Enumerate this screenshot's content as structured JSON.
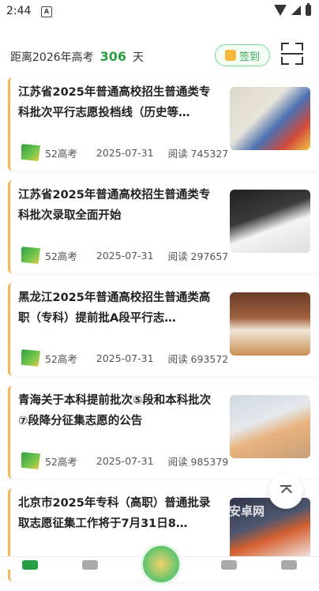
{
  "status_bar": {
    "time": "2:44",
    "notification_icon": "A"
  },
  "header": {
    "countdown_prefix": "距离2026年高考",
    "days": "306",
    "days_unit": "天",
    "checkin_label": "签到"
  },
  "articles": [
    {
      "title": "江苏省2025年普通高校招生普通类专科批次平行志愿投档线（历史等…",
      "source": "52高考",
      "date": "2025-07-31",
      "reads": "阅读 745327"
    },
    {
      "title": "江苏省2025年普通高校招生普通类专科批次录取全面开始",
      "source": "52高考",
      "date": "2025-07-31",
      "reads": "阅读 297657"
    },
    {
      "title": "黑龙江2025年普通高校招生普通类高职（专科）提前批A段平行志…",
      "source": "52高考",
      "date": "2025-07-31",
      "reads": "阅读 693572"
    },
    {
      "title": "青海关于本科提前批次⑤段和本科批次⑦段降分征集志愿的公告",
      "source": "52高考",
      "date": "2025-07-31",
      "reads": "阅读 985379"
    },
    {
      "title": "北京市2025年专科（高职）普通批录取志愿征集工作将于7月31日8…",
      "source": "",
      "date": "",
      "reads": ""
    }
  ],
  "watermark": "安卓网",
  "colors": {
    "accent": "#2a9d43",
    "card_border": "#f3b35a"
  }
}
